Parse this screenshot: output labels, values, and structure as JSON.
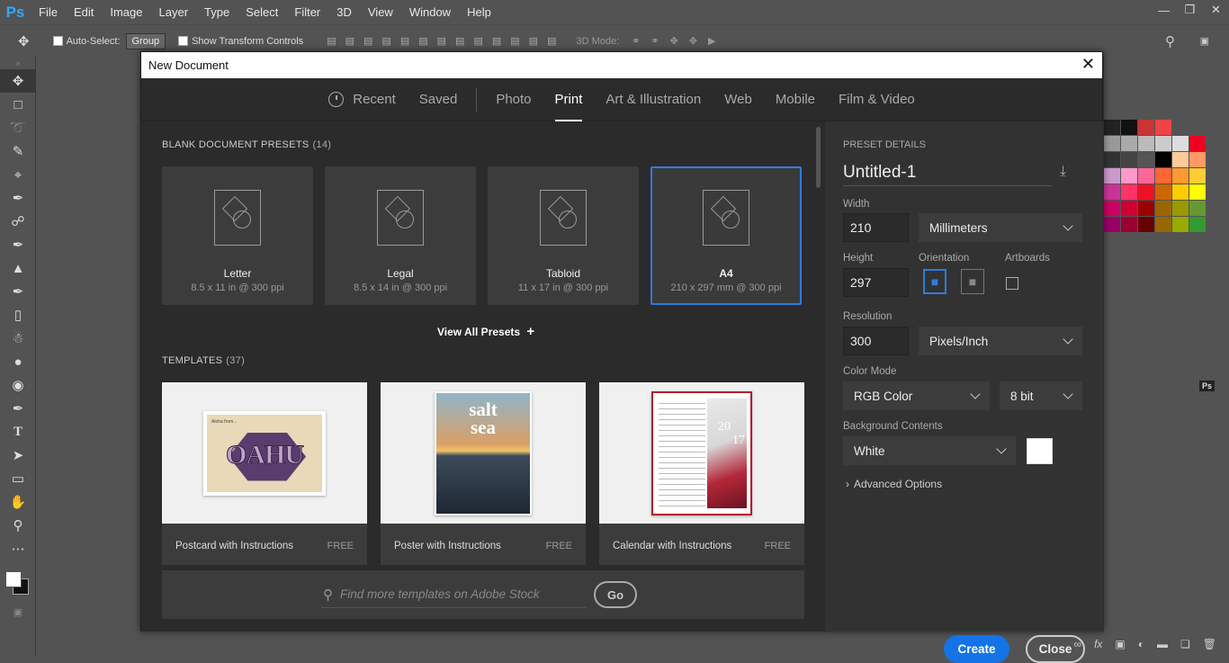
{
  "app": {
    "logo": "Ps"
  },
  "menu": [
    "File",
    "Edit",
    "Image",
    "Layer",
    "Type",
    "Select",
    "Filter",
    "3D",
    "View",
    "Window",
    "Help"
  ],
  "options": {
    "auto_select": "Auto-Select:",
    "group": "Group",
    "show_transform": "Show Transform Controls",
    "mode_3d": "3D Mode:"
  },
  "dialog": {
    "title": "New Document",
    "tabs": [
      "Recent",
      "Saved",
      "Photo",
      "Print",
      "Art & Illustration",
      "Web",
      "Mobile",
      "Film & Video"
    ],
    "active_tab": "Print",
    "presets_header": "BLANK DOCUMENT PRESETS",
    "presets_count": "(14)",
    "presets": [
      {
        "name": "Letter",
        "size": "8.5 x 11 in @ 300 ppi"
      },
      {
        "name": "Legal",
        "size": "8.5 x 14 in @ 300 ppi"
      },
      {
        "name": "Tabloid",
        "size": "11 x 17 in @ 300 ppi"
      },
      {
        "name": "A4",
        "size": "210 x 297 mm @ 300 ppi"
      }
    ],
    "view_all": "View All Presets",
    "view_all_plus": "+",
    "templates_header": "TEMPLATES",
    "templates_count": "(37)",
    "templates": [
      {
        "name": "Postcard with Instructions",
        "price": "FREE",
        "art_text": "OAHU",
        "art_small": "Aloha from..."
      },
      {
        "name": "Poster with Instructions",
        "price": "FREE",
        "art_text": "salt",
        "art_text2": "sea"
      },
      {
        "name": "Calendar with Instructions",
        "price": "FREE",
        "art_text": "20",
        "art_text2": "17"
      }
    ],
    "stock_placeholder": "Find more templates on Adobe Stock",
    "go": "Go",
    "details": {
      "header": "PRESET DETAILS",
      "name": "Untitled-1",
      "width_label": "Width",
      "width": "210",
      "unit": "Millimeters",
      "height_label": "Height",
      "height": "297",
      "orientation_label": "Orientation",
      "artboards_label": "Artboards",
      "resolution_label": "Resolution",
      "resolution": "300",
      "res_unit": "Pixels/Inch",
      "color_mode_label": "Color Mode",
      "color_mode": "RGB Color",
      "bit_depth": "8 bit",
      "bg_label": "Background Contents",
      "bg": "White",
      "advanced": "Advanced Options"
    },
    "create": "Create",
    "close": "Close"
  },
  "panel_badge": "Ps",
  "colors": {
    "accent": "#1473e6",
    "selected_border": "#2e7bdf"
  }
}
